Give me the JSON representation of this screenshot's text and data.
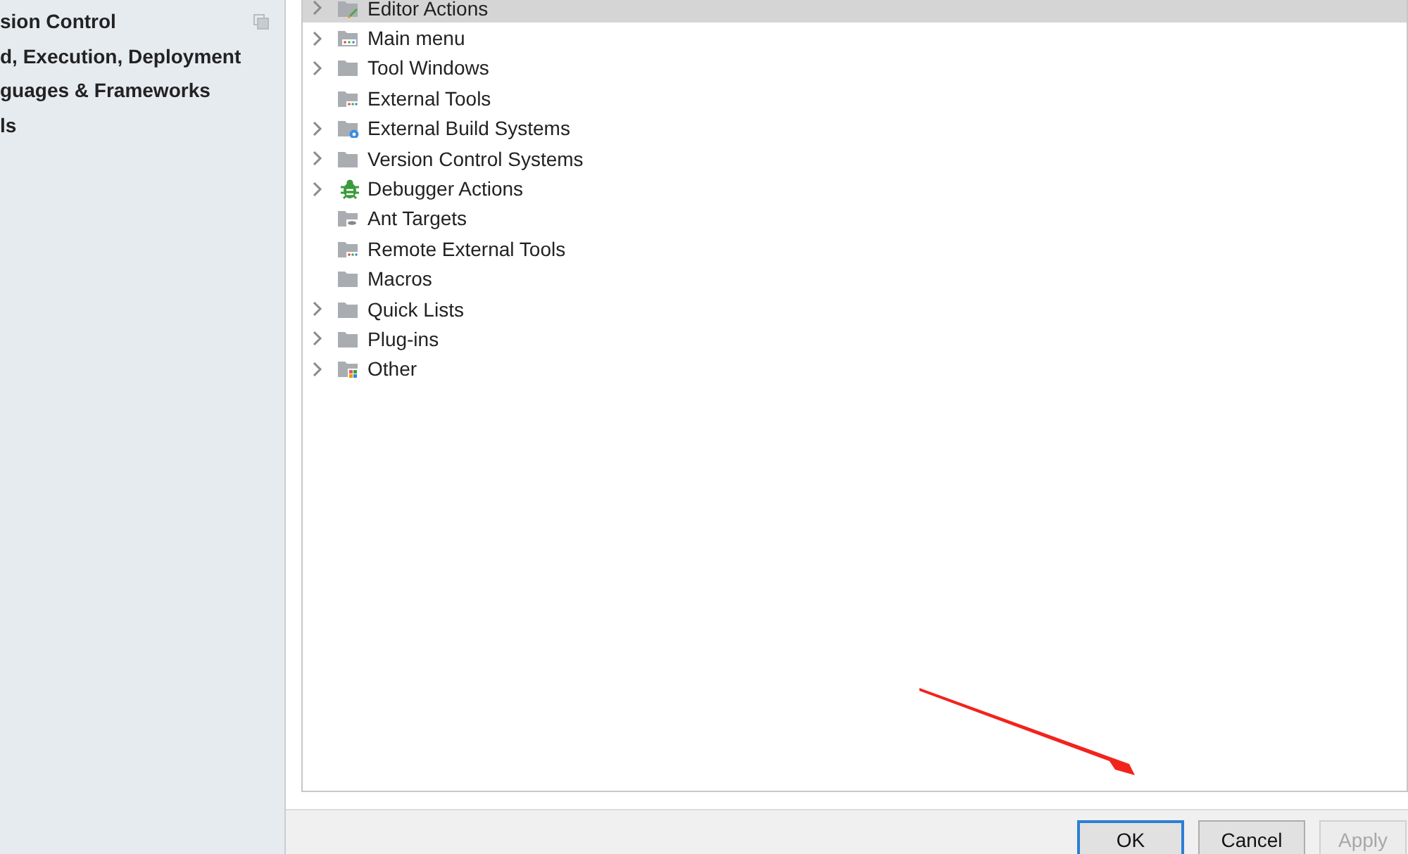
{
  "sidebar": {
    "items": [
      {
        "label": "sion Control",
        "selected": false
      },
      {
        "label": "d, Execution, Deployment",
        "selected": false
      },
      {
        "label": "guages & Frameworks",
        "selected": false
      },
      {
        "label": "ls",
        "selected": false
      }
    ]
  },
  "tree": {
    "items": [
      {
        "label": "Editor Actions",
        "kind": "folder-pencil",
        "expandable": true,
        "selected": true
      },
      {
        "label": "Main menu",
        "kind": "folder-menu",
        "expandable": true,
        "selected": false
      },
      {
        "label": "Tool Windows",
        "kind": "folder",
        "expandable": true,
        "selected": false
      },
      {
        "label": "External Tools",
        "kind": "folder-dots",
        "expandable": false,
        "selected": false
      },
      {
        "label": "External Build Systems",
        "kind": "folder-gear",
        "expandable": true,
        "selected": false
      },
      {
        "label": "Version Control Systems",
        "kind": "folder",
        "expandable": true,
        "selected": false
      },
      {
        "label": "Debugger Actions",
        "kind": "bug",
        "expandable": true,
        "selected": false
      },
      {
        "label": "Ant Targets",
        "kind": "folder-ant",
        "expandable": false,
        "selected": false
      },
      {
        "label": "Remote External Tools",
        "kind": "folder-dots",
        "expandable": false,
        "selected": false
      },
      {
        "label": "Macros",
        "kind": "folder",
        "expandable": false,
        "selected": false
      },
      {
        "label": "Quick Lists",
        "kind": "folder",
        "expandable": true,
        "selected": false
      },
      {
        "label": "Plug-ins",
        "kind": "folder",
        "expandable": true,
        "selected": false
      },
      {
        "label": "Other",
        "kind": "folder-grid",
        "expandable": true,
        "selected": false
      }
    ]
  },
  "buttons": [
    {
      "label": "OK",
      "default": true,
      "disabled": false
    },
    {
      "label": "Cancel",
      "default": false,
      "disabled": false
    },
    {
      "label": "Apply",
      "default": false,
      "disabled": true
    }
  ]
}
